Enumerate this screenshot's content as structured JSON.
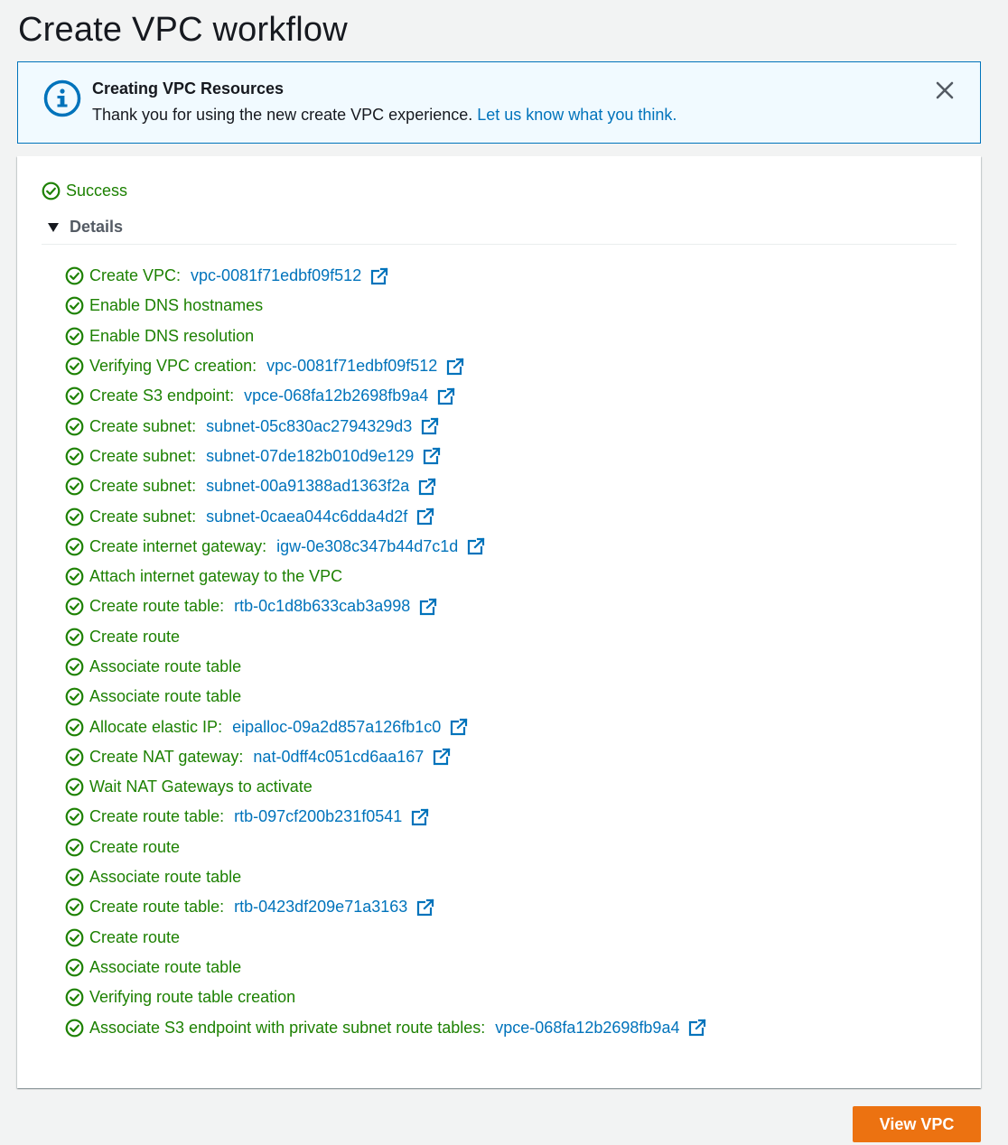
{
  "page": {
    "title": "Create VPC workflow"
  },
  "flash": {
    "title": "Creating VPC Resources",
    "message": "Thank you for using the new create VPC experience.",
    "link": "Let us know what you think.",
    "icon": "info-icon",
    "close_icon": "close-icon"
  },
  "status": {
    "label": "Success"
  },
  "details": {
    "label": "Details",
    "expanded": true
  },
  "steps": [
    {
      "text": "Create VPC: ",
      "link": "vpc-0081f71edbf09f512"
    },
    {
      "text": "Enable DNS hostnames"
    },
    {
      "text": "Enable DNS resolution"
    },
    {
      "text": "Verifying VPC creation: ",
      "link": "vpc-0081f71edbf09f512"
    },
    {
      "text": "Create S3 endpoint: ",
      "link": "vpce-068fa12b2698fb9a4"
    },
    {
      "text": "Create subnet: ",
      "link": "subnet-05c830ac2794329d3"
    },
    {
      "text": "Create subnet: ",
      "link": "subnet-07de182b010d9e129"
    },
    {
      "text": "Create subnet: ",
      "link": "subnet-00a91388ad1363f2a"
    },
    {
      "text": "Create subnet: ",
      "link": "subnet-0caea044c6dda4d2f"
    },
    {
      "text": "Create internet gateway: ",
      "link": "igw-0e308c347b44d7c1d"
    },
    {
      "text": "Attach internet gateway to the VPC"
    },
    {
      "text": "Create route table: ",
      "link": "rtb-0c1d8b633cab3a998"
    },
    {
      "text": "Create route"
    },
    {
      "text": "Associate route table"
    },
    {
      "text": "Associate route table"
    },
    {
      "text": "Allocate elastic IP: ",
      "link": "eipalloc-09a2d857a126fb1c0"
    },
    {
      "text": "Create NAT gateway: ",
      "link": "nat-0dff4c051cd6aa167"
    },
    {
      "text": "Wait NAT Gateways to activate"
    },
    {
      "text": "Create route table: ",
      "link": "rtb-097cf200b231f0541"
    },
    {
      "text": "Create route"
    },
    {
      "text": "Associate route table"
    },
    {
      "text": "Create route table: ",
      "link": "rtb-0423df209e71a3163"
    },
    {
      "text": "Create route"
    },
    {
      "text": "Associate route table"
    },
    {
      "text": "Verifying route table creation"
    },
    {
      "text": "Associate S3 endpoint with private subnet route tables: ",
      "link": "vpce-068fa12b2698fb9a4"
    }
  ],
  "actions": {
    "view_vpc": "View VPC"
  },
  "colors": {
    "success": "#1d8102",
    "link": "#0073bb",
    "primary_button": "#ec7211",
    "info_border": "#0073bb",
    "info_bg": "#f1faff"
  }
}
